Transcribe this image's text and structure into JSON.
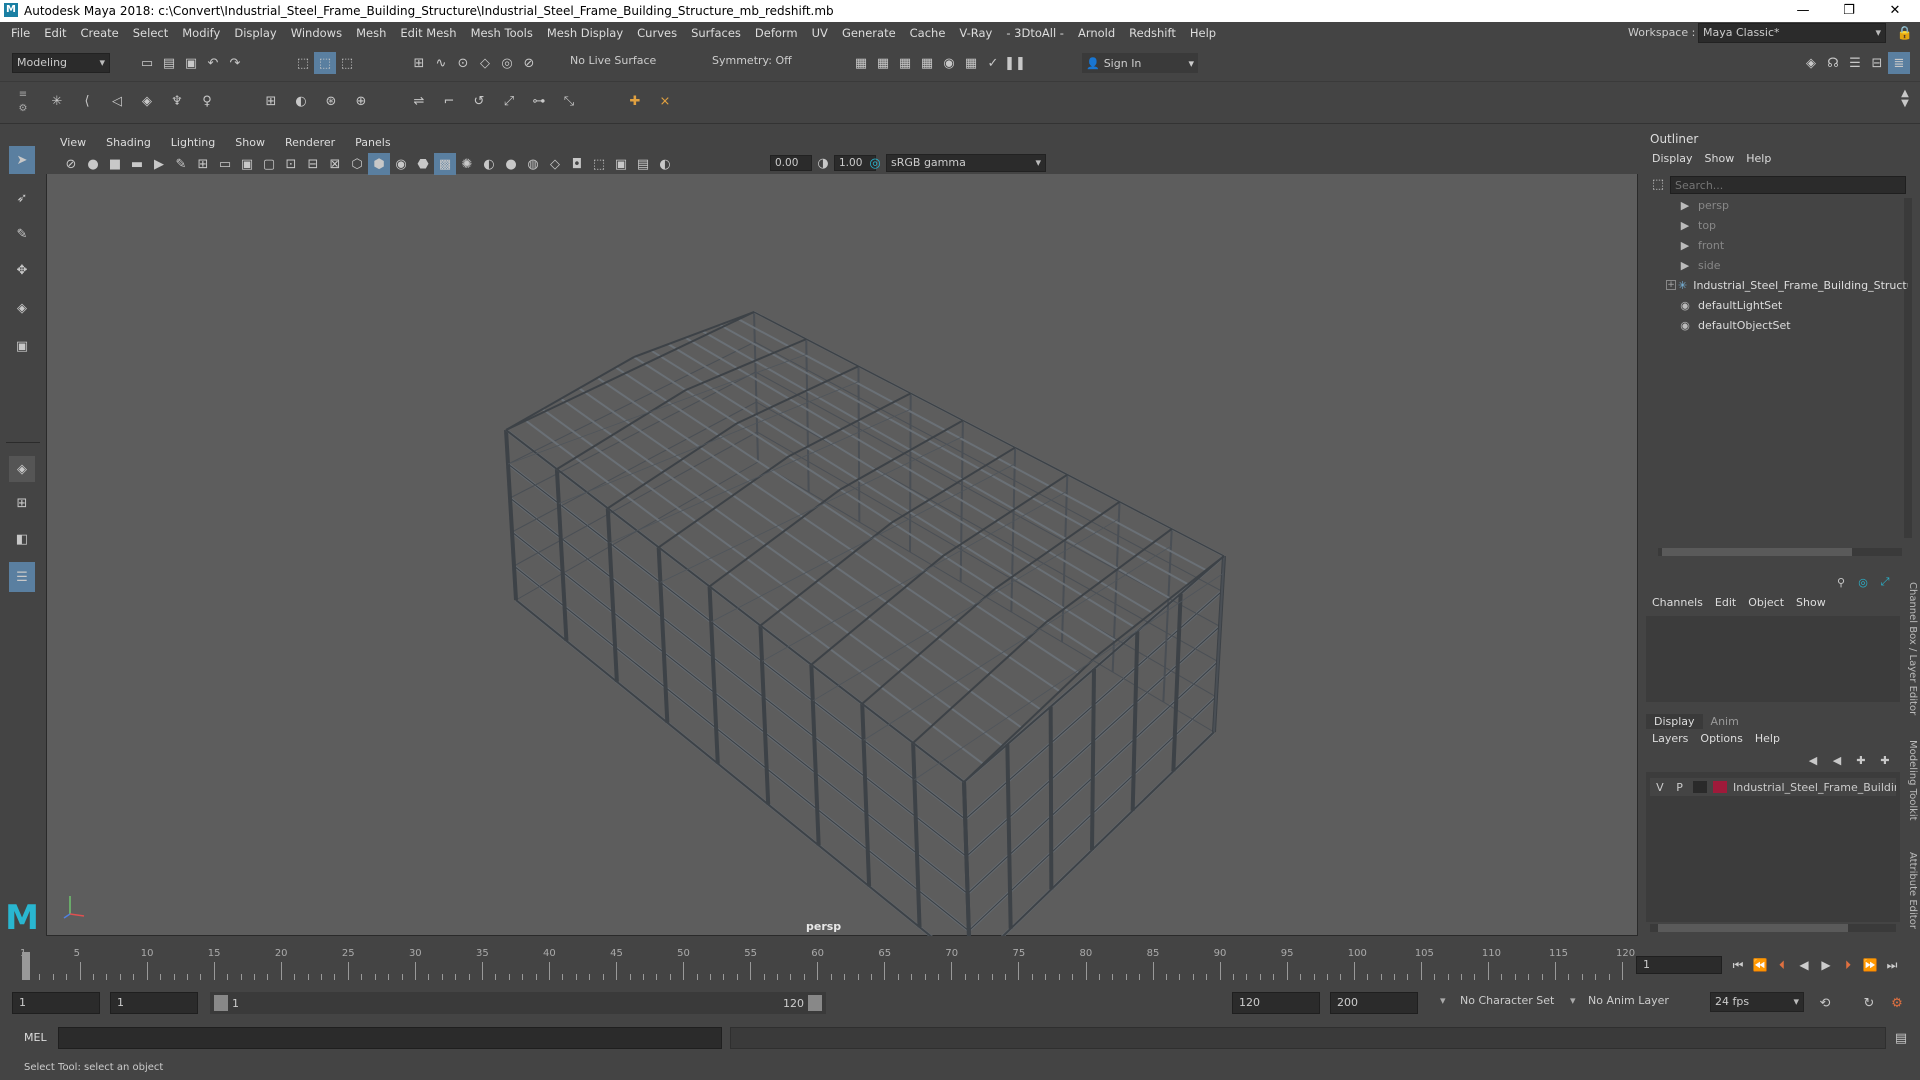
{
  "window": {
    "title": "Autodesk Maya 2018: c:\\Convert\\Industrial_Steel_Frame_Building_Structure\\Industrial_Steel_Frame_Building_Structure_mb_redshift.mb",
    "logo": "M"
  },
  "menu": [
    "File",
    "Edit",
    "Create",
    "Select",
    "Modify",
    "Display",
    "Windows",
    "Mesh",
    "Edit Mesh",
    "Mesh Tools",
    "Mesh Display",
    "Curves",
    "Surfaces",
    "Deform",
    "UV",
    "Generate",
    "Cache",
    "V-Ray",
    "- 3DtoAll -",
    "Arnold",
    "Redshift",
    "Help"
  ],
  "workspace": {
    "label": "Workspace :",
    "value": "Maya Classic*"
  },
  "status_line": {
    "mode": "Modeling",
    "live_surface": "No Live Surface",
    "symmetry": "Symmetry: Off",
    "sign_in": "Sign In"
  },
  "viewport": {
    "menu": [
      "View",
      "Shading",
      "Lighting",
      "Show",
      "Renderer",
      "Panels"
    ],
    "exposure": "0.00",
    "gamma": "1.00",
    "color_space": "sRGB gamma",
    "camera_label": "persp"
  },
  "outliner": {
    "title": "Outliner",
    "menu": [
      "Display",
      "Show",
      "Help"
    ],
    "search_placeholder": "Search...",
    "items": [
      {
        "label": "persp",
        "icon": "camera-icon",
        "dim": true
      },
      {
        "label": "top",
        "icon": "camera-icon",
        "dim": true
      },
      {
        "label": "front",
        "icon": "camera-icon",
        "dim": true
      },
      {
        "label": "side",
        "icon": "camera-icon",
        "dim": true
      },
      {
        "label": "Industrial_Steel_Frame_Building_Structu",
        "icon": "transform-icon",
        "dim": false
      },
      {
        "label": "defaultLightSet",
        "icon": "set-icon",
        "dim": false
      },
      {
        "label": "defaultObjectSet",
        "icon": "set-icon",
        "dim": false
      }
    ]
  },
  "channel_box": {
    "menu": [
      "Channels",
      "Edit",
      "Object",
      "Show"
    ]
  },
  "layer_editor": {
    "tabs": [
      "Display",
      "Anim"
    ],
    "menu": [
      "Layers",
      "Options",
      "Help"
    ],
    "layer": {
      "v": "V",
      "p": "P",
      "name": "Industrial_Steel_Frame_Buildir",
      "color": "#9e1a3a"
    }
  },
  "side_tabs": [
    "Channel Box / Layer Editor",
    "Modeling Toolkit",
    "Attribute Editor"
  ],
  "timeline": {
    "ticks": [
      1,
      5,
      10,
      15,
      20,
      25,
      30,
      35,
      40,
      45,
      50,
      55,
      60,
      65,
      70,
      75,
      80,
      85,
      90,
      95,
      100,
      105,
      110,
      115,
      120
    ],
    "current_frame": "1"
  },
  "range": {
    "start": "1",
    "playback_start": "1",
    "slider_start": "1",
    "slider_end": "120",
    "playback_end": "120",
    "end": "200",
    "character_set": "No Character Set",
    "anim_layer": "No Anim Layer",
    "fps": "24 fps"
  },
  "command": {
    "lang": "MEL"
  },
  "status": {
    "help_line": "Select Tool: select an object"
  }
}
